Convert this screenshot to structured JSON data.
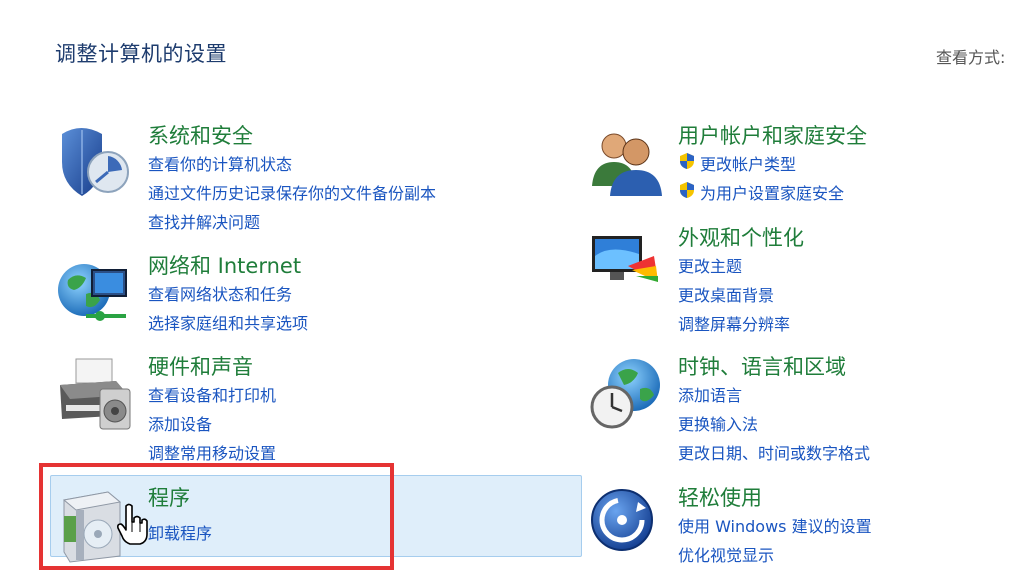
{
  "header": {
    "title": "调整计算机的设置",
    "view_by": "查看方式:"
  },
  "categories": [
    {
      "icon": "shield-security-icon",
      "title": "系统和安全",
      "links": [
        "查看你的计算机状态",
        "通过文件历史记录保存你的文件备份副本",
        "查找并解决问题"
      ]
    },
    {
      "icon": "network-globe-icon",
      "title": "网络和 Internet",
      "links": [
        "查看网络状态和任务",
        "选择家庭组和共享选项"
      ]
    },
    {
      "icon": "printer-speaker-icon",
      "title": "硬件和声音",
      "links": [
        "查看设备和打印机",
        "添加设备",
        "调整常用移动设置"
      ]
    },
    {
      "icon": "programs-box-icon",
      "title": "程序",
      "links": [
        "卸载程序"
      ]
    },
    {
      "icon": "users-icon",
      "title": "用户帐户和家庭安全",
      "links": [
        "更改帐户类型",
        "为用户设置家庭安全"
      ]
    },
    {
      "icon": "appearance-monitor-icon",
      "title": "外观和个性化",
      "links": [
        "更改主题",
        "更改桌面背景",
        "调整屏幕分辨率"
      ]
    },
    {
      "icon": "clock-globe-icon",
      "title": "时钟、语言和区域",
      "links": [
        "添加语言",
        "更换输入法",
        "更改日期、时间或数字格式"
      ]
    },
    {
      "icon": "ease-of-access-icon",
      "title": "轻松使用",
      "links": [
        "使用 Windows 建议的设置",
        "优化视觉显示"
      ]
    }
  ]
}
